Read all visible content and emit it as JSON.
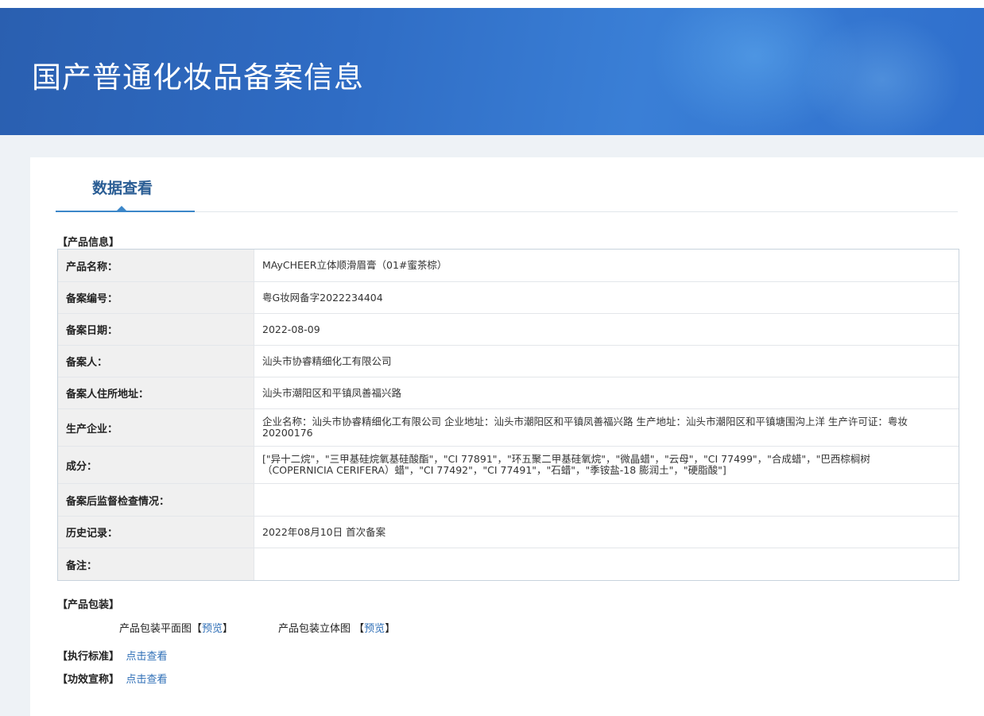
{
  "header": {
    "title": "国产普通化妆品备案信息"
  },
  "tab": {
    "label": "数据查看"
  },
  "sections": {
    "product_info": "【产品信息】",
    "product_packaging": "【产品包装】",
    "standard": "【执行标准】",
    "efficacy": "【功效宣称】"
  },
  "product_table": [
    {
      "label": "产品名称：",
      "value": "MAyCHEER立体顺滑眉膏（01#蜜茶棕）"
    },
    {
      "label": "备案编号：",
      "value": "粤G妆网备字2022234404"
    },
    {
      "label": "备案日期：",
      "value": "2022-08-09"
    },
    {
      "label": "备案人：",
      "value": "汕头市协睿精细化工有限公司"
    },
    {
      "label": "备案人住所地址：",
      "value": "汕头市潮阳区和平镇凤善福兴路"
    },
    {
      "label": "生产企业：",
      "value": "企业名称：汕头市协睿精细化工有限公司 企业地址：汕头市潮阳区和平镇凤善福兴路 生产地址：汕头市潮阳区和平镇塘围沟上洋 生产许可证：粤妆20200176"
    },
    {
      "label": "成分：",
      "value": "[\"异十二烷\"，\"三甲基硅烷氧基硅酸酯\"，\"CI 77891\"，\"环五聚二甲基硅氧烷\"，\"微晶蜡\"，\"云母\"，\"CI 77499\"，\"合成蜡\"，\"巴西棕榈树（COPERNICIA CERIFERA）蜡\"，\"CI 77492\"，\"CI 77491\"，\"石蜡\"，\"季铵盐-18 膨润土\"，\"硬脂酸\"]"
    },
    {
      "label": "备案后监督检查情况：",
      "value": ""
    },
    {
      "label": "历史记录：",
      "value": "2022年08月10日 首次备案"
    },
    {
      "label": "备注：",
      "value": ""
    }
  ],
  "packaging": {
    "flat_label": "产品包装平面图",
    "solid_label": "产品包装立体图",
    "preview_open": "【",
    "preview_text": "预览",
    "preview_close": "】"
  },
  "links": {
    "view": "点击查看"
  }
}
